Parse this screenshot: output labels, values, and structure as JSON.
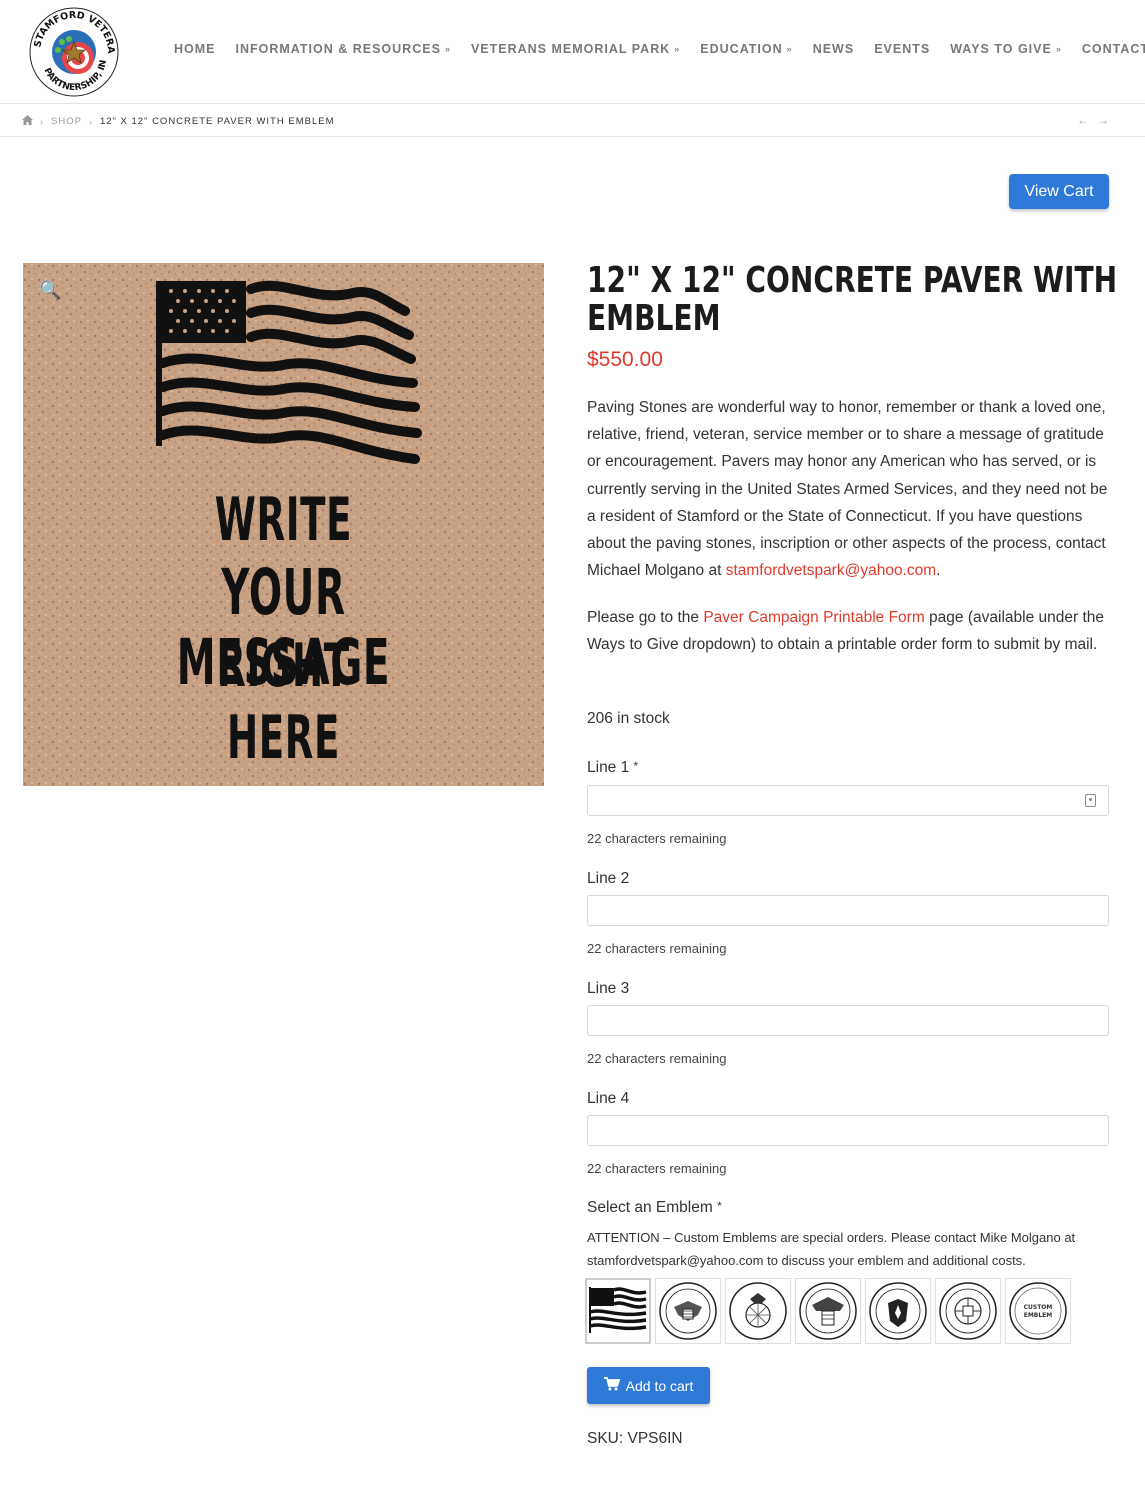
{
  "logo": {
    "text_top": "STAMFORD VETERANS PARK",
    "text_bottom": "PARTNERSHIP, INC."
  },
  "nav": [
    {
      "label": "HOME",
      "dropdown": false
    },
    {
      "label": "INFORMATION & RESOURCES",
      "dropdown": true
    },
    {
      "label": "VETERANS MEMORIAL PARK",
      "dropdown": true
    },
    {
      "label": "EDUCATION",
      "dropdown": true
    },
    {
      "label": "NEWS",
      "dropdown": false
    },
    {
      "label": "EVENTS",
      "dropdown": false
    },
    {
      "label": "WAYS TO GIVE",
      "dropdown": true
    },
    {
      "label": "CONTACT",
      "dropdown": false
    }
  ],
  "breadcrumb": {
    "home_icon": "home-icon",
    "shop": "SHOP",
    "current": "12\" X 12\" CONCRETE PAVER WITH EMBLEM"
  },
  "pager": {
    "prev": "←",
    "next": "→"
  },
  "view_cart_label": "View Cart",
  "product": {
    "image_lines": [
      "WRITE",
      "YOUR MESSAGE",
      "RIGHT",
      "HERE"
    ],
    "title_line1": "12\" X 12\" CONCRETE PAVER WITH",
    "title_line2": "EMBLEM",
    "price": "$550.00",
    "description": "Paving Stones are wonderful way to honor, remember or thank a loved one, relative, friend, veteran, service member or to share a message of gratitude or encouragement. Pavers may honor any American who has served, or is currently serving in the United States Armed Services, and they need not be a resident of Stamford or the State of Connecticut. If you have questions about the paving stones, inscription or other aspects of the process, contact Michael Molgano at ",
    "description_email": "stamfordvetspark@yahoo.com",
    "description_end": ".",
    "desc2_start": "Please go to the ",
    "desc2_link": "Paver Campaign Printable Form",
    "desc2_end": " page (available under the Ways to Give dropdown) to obtain a printable order form to submit by mail.",
    "stock": "206 in stock",
    "fields": [
      {
        "label": "Line 1",
        "required": "*",
        "value": "",
        "remaining": "22 characters remaining"
      },
      {
        "label": "Line 2",
        "required": "",
        "value": "",
        "remaining": "22 characters remaining"
      },
      {
        "label": "Line 3",
        "required": "",
        "value": "",
        "remaining": "22 characters remaining"
      },
      {
        "label": "Line 4",
        "required": "",
        "value": "",
        "remaining": "22 characters remaining"
      }
    ],
    "emblem_label": "Select an Emblem",
    "emblem_required": "*",
    "attention": "ATTENTION – Custom Emblems are special orders. Please contact Mike Molgano at stamfordvetspark@yahoo.com to discuss your emblem and additional costs.",
    "emblems": [
      {
        "name": "flag-emblem"
      },
      {
        "name": "army-emblem"
      },
      {
        "name": "marines-emblem"
      },
      {
        "name": "navy-emblem"
      },
      {
        "name": "air-force-emblem"
      },
      {
        "name": "coast-guard-emblem"
      },
      {
        "name": "custom-emblem",
        "text": "CUSTOM EMBLEM"
      }
    ],
    "add_to_cart_label": "Add to cart",
    "sku": "SKU: VPS6IN"
  },
  "colors": {
    "accent_blue": "#2f7ad8",
    "price_red": "#e03a2d",
    "nav_gray": "#777777"
  }
}
